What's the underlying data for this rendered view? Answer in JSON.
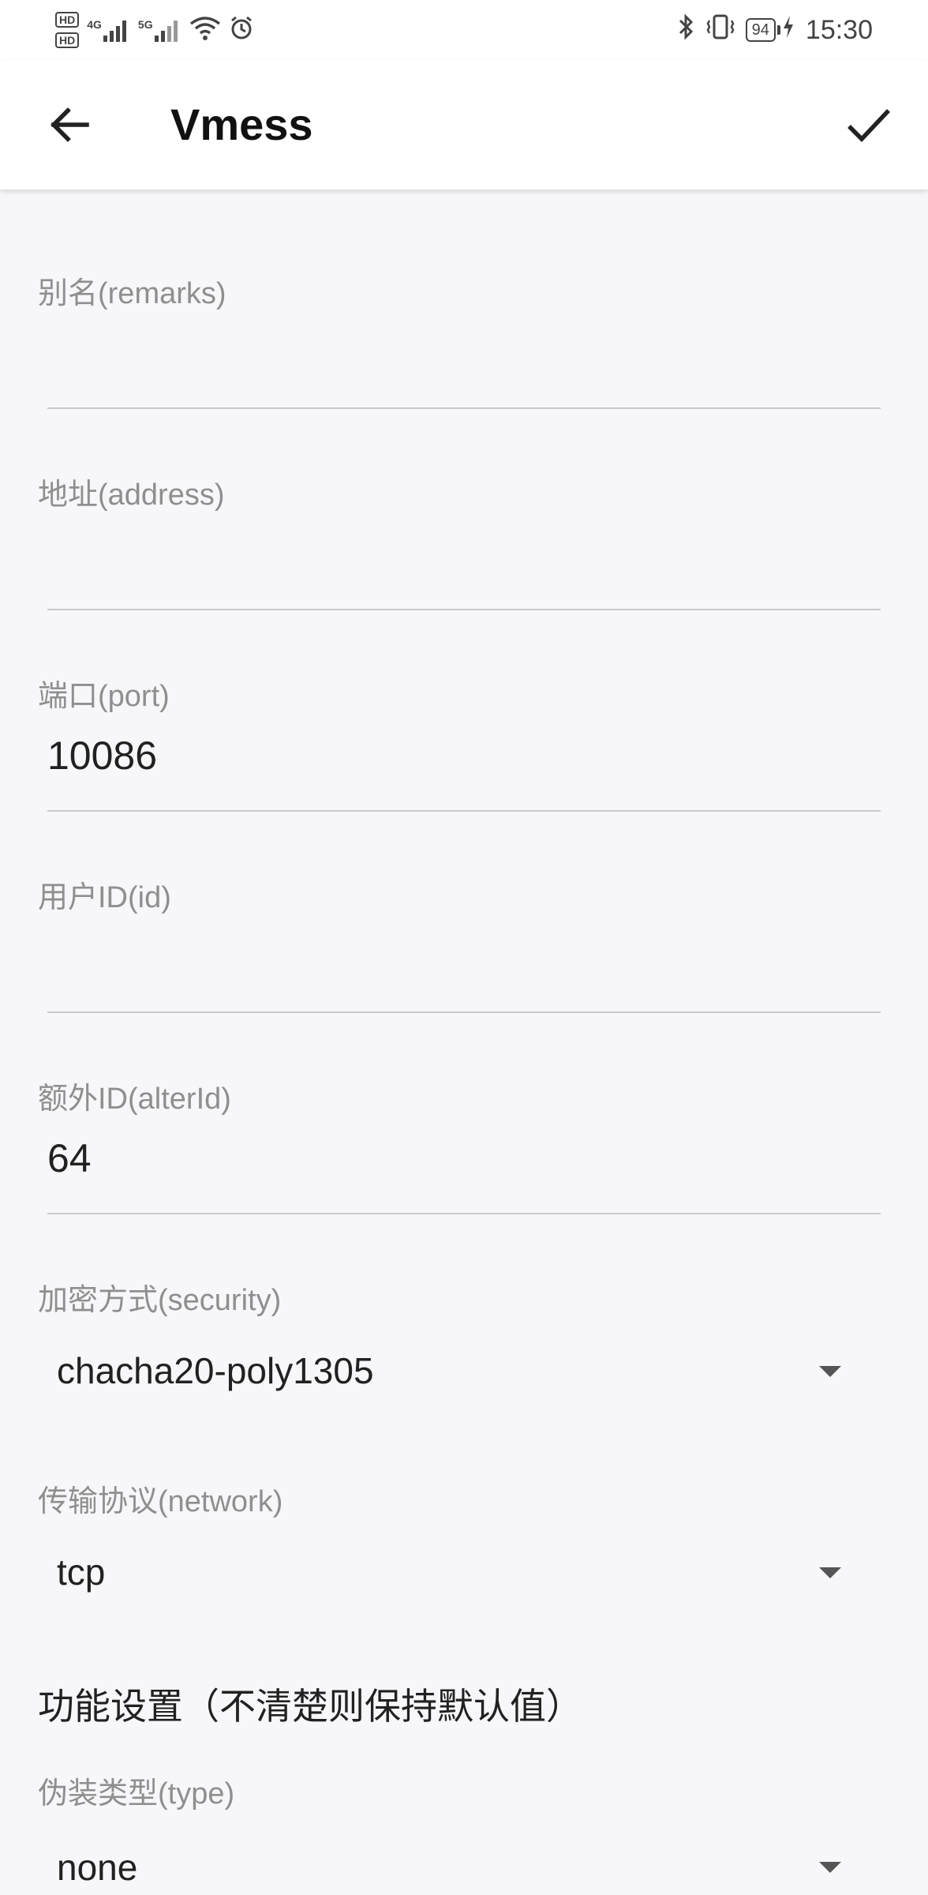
{
  "status_bar": {
    "hd1": "HD",
    "hd2": "HD",
    "network1": "4G",
    "network2": "5G",
    "battery": "94",
    "time": "15:30"
  },
  "toolbar": {
    "title": "Vmess"
  },
  "fields": {
    "remarks": {
      "label": "别名(remarks)",
      "value": ""
    },
    "address": {
      "label": "地址(address)",
      "value": ""
    },
    "port": {
      "label": "端口(port)",
      "value": "10086"
    },
    "id": {
      "label": "用户ID(id)",
      "value": ""
    },
    "alterId": {
      "label": "额外ID(alterId)",
      "value": "64"
    }
  },
  "spinners": {
    "security": {
      "label": "加密方式(security)",
      "value": "chacha20-poly1305"
    },
    "network": {
      "label": "传输协议(network)",
      "value": "tcp"
    },
    "type": {
      "label": "伪装类型(type)",
      "value": "none"
    }
  },
  "section": {
    "feature_settings": "功能设置（不清楚则保持默认值）"
  }
}
